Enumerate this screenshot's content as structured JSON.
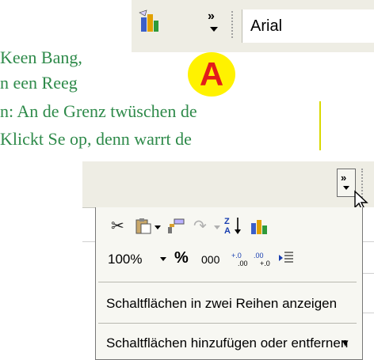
{
  "article": {
    "line1": "Keen Bang,",
    "line2": "n een Reeg",
    "line3": "n: An de Grenz twüschen de",
    "line4": "Klickt Se op, denn warrt de"
  },
  "top_toolbar": {
    "font_name": "Arial",
    "more_buttons_glyph": "»",
    "badge_letter": "A"
  },
  "popup_toolbar": {
    "zoom": "100%",
    "percent_glyph": "%",
    "thousands_label": "000",
    "increase_decimal": "¹⁰",
    "decrease_decimal": "¹⁰",
    "more_buttons_glyph": "»",
    "menu_item_show_two_rows": "Schaltflächen in zwei Reihen anzeigen",
    "menu_item_add_remove": "Schaltflächen hinzufügen oder entfernen",
    "menu_item_add_remove_arrow": "▾"
  },
  "colors": {
    "text_green": "#2e8a4a",
    "toolbar_bg": "#eeede4",
    "badge_yellow": "#fff200",
    "badge_red": "#e21b1b"
  }
}
